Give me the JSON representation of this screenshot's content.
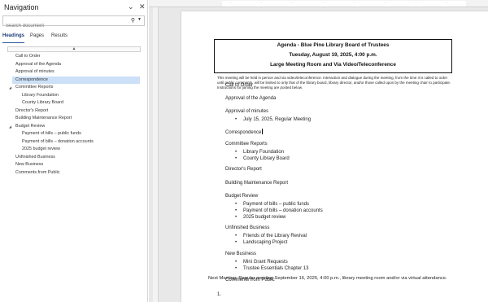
{
  "nav": {
    "title": "Navigation",
    "search_placeholder": "Search document",
    "tabs": [
      "Headings",
      "Pages",
      "Results"
    ],
    "scroll_up": "▲",
    "items": [
      {
        "label": "Call to Order",
        "level": 1
      },
      {
        "label": "Approval of the Agenda",
        "level": 1
      },
      {
        "label": "Approval of minutes",
        "level": 1
      },
      {
        "label": "Correspondence",
        "level": 1,
        "selected": true
      },
      {
        "label": "Committee Reports",
        "level": 1,
        "expanded": true
      },
      {
        "label": "Library Foundation",
        "level": 2
      },
      {
        "label": "County Library Board",
        "level": 2
      },
      {
        "label": "Director's Report",
        "level": 1
      },
      {
        "label": "Building Maintenance Report",
        "level": 1
      },
      {
        "label": "Budget Review",
        "level": 1,
        "expanded": true
      },
      {
        "label": "Payment of bills – public funds",
        "level": 2
      },
      {
        "label": "Payment of bills – donation accounts",
        "level": 2
      },
      {
        "label": "2025 budget review",
        "level": 2
      },
      {
        "label": "Unfinished Business",
        "level": 1
      },
      {
        "label": "New Business",
        "level": 1
      },
      {
        "label": "Comments from Public",
        "level": 1
      }
    ]
  },
  "document": {
    "title_lines": [
      "Agenda - Blue Pine Library Board of Trustees",
      "Tuesday, August 19, 2025, 4:00 p.m.",
      "Large Meeting Room and Via Video/Teleconference"
    ],
    "intro": "This meeting will be held in person and via video/teleconference. Interaction and dialogue during the meeting, from the time it is called to order until public comments, will be limited to only that of the library board, library director, and/or those called upon by the meeting chair to participate. Instructions for joining the meeting are posted below.",
    "sections": [
      {
        "heading": "Call to Order",
        "bullets": []
      },
      {
        "heading": "Approval of the Agenda",
        "bullets": []
      },
      {
        "heading": "Approval of minutes",
        "bullets": [
          "July 15, 2025, Regular Meeting"
        ]
      },
      {
        "heading": "Correspondence",
        "bullets": []
      },
      {
        "heading": "Committee Reports",
        "bullets": [
          "Library Foundation",
          "County Library Board"
        ]
      },
      {
        "heading": "Director's Report",
        "bullets": []
      },
      {
        "heading": "Building Maintenance Report",
        "bullets": []
      },
      {
        "heading": "Budget Review",
        "bullets": [
          "Payment of bills – public funds",
          "Payment of bills – donation accounts",
          "2025 budget review"
        ]
      },
      {
        "heading": "Unfinished Business",
        "bullets": [
          "Friends of the Library Revival",
          "Landscaping Project"
        ]
      },
      {
        "heading": "New Business",
        "bullets": [
          "Mini Grant Requests",
          "Trustee Essentials Chapter 13"
        ]
      },
      {
        "heading": "Comments from Public",
        "bullets": []
      }
    ],
    "next_meeting": "Next Meeting: Regular meeting September 16, 2025, 4:00 p.m., library meeting room and/or via virtual attendance.",
    "list_number": "1."
  },
  "colors": {
    "selected_bg": "#cce0f7",
    "tab_accent": "#2b579a"
  }
}
